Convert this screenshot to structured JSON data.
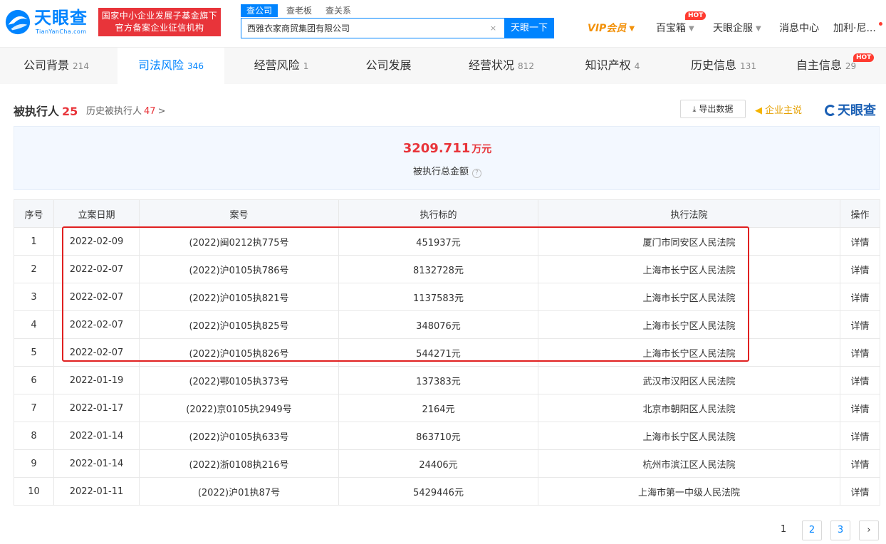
{
  "header": {
    "logo_cn": "天眼查",
    "logo_en": "TianYanCha.com",
    "badge_line1": "国家中小企业发展子基金旗下",
    "badge_line2": "官方备案企业征信机构",
    "search_tabs": [
      "查公司",
      "查老板",
      "查关系"
    ],
    "search_value": "西雅衣家商贸集团有限公司",
    "search_clear": "×",
    "search_button": "天眼一下",
    "nav": {
      "vip": "VIP会员",
      "baibaoxiang": "百宝箱",
      "hot": "HOT",
      "qifu": "天眼企服",
      "messages": "消息中心",
      "user": "加利·尼..."
    }
  },
  "tabs": [
    {
      "label": "公司背景",
      "count": "214"
    },
    {
      "label": "司法风险",
      "count": "346"
    },
    {
      "label": "经营风险",
      "count": "1"
    },
    {
      "label": "公司发展",
      "count": ""
    },
    {
      "label": "经营状况",
      "count": "812"
    },
    {
      "label": "知识产权",
      "count": "4"
    },
    {
      "label": "历史信息",
      "count": "131"
    },
    {
      "label": "自主信息",
      "count": "29"
    }
  ],
  "tabs_hot": "HOT",
  "section": {
    "title": "被执行人",
    "count": "25",
    "history_label": "历史被执行人",
    "history_count": "47",
    "history_chevron": ">",
    "export_label": "导出数据",
    "owner_label": "企业主说",
    "brand": "天眼查"
  },
  "summary": {
    "amount": "3209.711",
    "unit": "万元",
    "label": "被执行总金额",
    "help": "?"
  },
  "table": {
    "headers": [
      "序号",
      "立案日期",
      "案号",
      "执行标的",
      "执行法院",
      "操作"
    ],
    "rows": [
      {
        "no": "1",
        "date": "2022-02-09",
        "case": "(2022)闽0212执775号",
        "amount": "451937元",
        "court": "厦门市同安区人民法院",
        "action": "详情"
      },
      {
        "no": "2",
        "date": "2022-02-07",
        "case": "(2022)沪0105执786号",
        "amount": "8132728元",
        "court": "上海市长宁区人民法院",
        "action": "详情"
      },
      {
        "no": "3",
        "date": "2022-02-07",
        "case": "(2022)沪0105执821号",
        "amount": "1137583元",
        "court": "上海市长宁区人民法院",
        "action": "详情"
      },
      {
        "no": "4",
        "date": "2022-02-07",
        "case": "(2022)沪0105执825号",
        "amount": "348076元",
        "court": "上海市长宁区人民法院",
        "action": "详情"
      },
      {
        "no": "5",
        "date": "2022-02-07",
        "case": "(2022)沪0105执826号",
        "amount": "544271元",
        "court": "上海市长宁区人民法院",
        "action": "详情"
      },
      {
        "no": "6",
        "date": "2022-01-19",
        "case": "(2022)鄂0105执373号",
        "amount": "137383元",
        "court": "武汉市汉阳区人民法院",
        "action": "详情"
      },
      {
        "no": "7",
        "date": "2022-01-17",
        "case": "(2022)京0105执2949号",
        "amount": "2164元",
        "court": "北京市朝阳区人民法院",
        "action": "详情"
      },
      {
        "no": "8",
        "date": "2022-01-14",
        "case": "(2022)沪0105执633号",
        "amount": "863710元",
        "court": "上海市长宁区人民法院",
        "action": "详情"
      },
      {
        "no": "9",
        "date": "2022-01-14",
        "case": "(2022)浙0108执216号",
        "amount": "24406元",
        "court": "杭州市滨江区人民法院",
        "action": "详情"
      },
      {
        "no": "10",
        "date": "2022-01-11",
        "case": "(2022)沪01执87号",
        "amount": "5429446元",
        "court": "上海市第一中级人民法院",
        "action": "详情"
      }
    ]
  },
  "pagination": {
    "pages": [
      "1",
      "2",
      "3"
    ],
    "current": "1",
    "next": "›"
  },
  "colors": {
    "brand_blue": "#0084ff",
    "accent_red": "#e8343a",
    "vip_orange": "#f2910a",
    "highlight_red": "#e02020"
  },
  "icons": {
    "logo": "tianyancha-logo-icon",
    "export": "download-icon",
    "owner": "megaphone-icon",
    "help": "question-circle-icon",
    "next": "chevron-right-icon"
  }
}
